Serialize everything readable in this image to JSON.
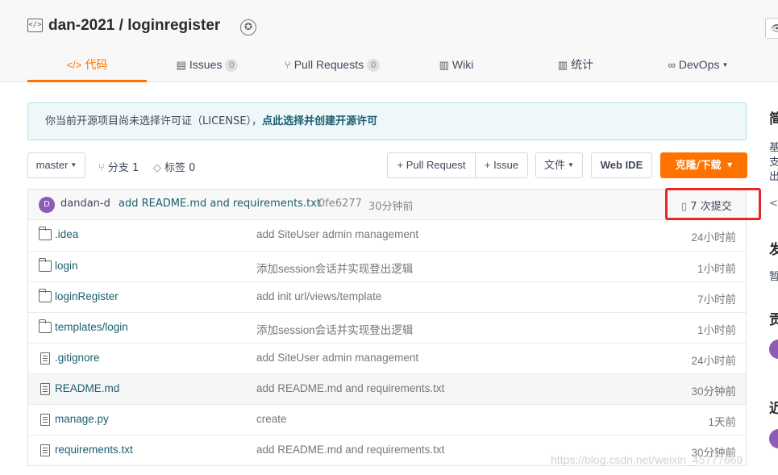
{
  "repo": {
    "title": "dan-2021 / loginregister"
  },
  "tabs": [
    {
      "icon": "</>",
      "label": "代码"
    },
    {
      "icon": "▤",
      "label": "Issues",
      "count": "0"
    },
    {
      "icon": "⑂",
      "label": "Pull Requests",
      "count": "0"
    },
    {
      "icon": "▥",
      "label": "Wiki"
    },
    {
      "icon": "▥",
      "label": "统计"
    },
    {
      "icon": "∞",
      "label": "DevOps"
    }
  ],
  "license": {
    "text": "你当前开源项目尚未选择许可证（LICENSE），",
    "link": "点此选择并创建开源许可"
  },
  "toolbar": {
    "branch": "master",
    "branches_label": "分支",
    "branches_count": "1",
    "tags_label": "标签",
    "tags_count": "0",
    "pull_request": "+ Pull Request",
    "issue": "+ Issue",
    "file": "文件",
    "web_ide": "Web IDE",
    "clone": "克隆/下载"
  },
  "commit": {
    "avatar_letter": "D",
    "author": "dandan-d",
    "message": "add README.md and requirements.txt",
    "sha": "0fe6277",
    "time": "30分钟前",
    "count": "7 次提交"
  },
  "files": [
    {
      "type": "folder",
      "name": ".idea",
      "message": "add SiteUser admin management",
      "time": "24小时前"
    },
    {
      "type": "folder",
      "name": "login",
      "message": "添加session会话并实现登出逻辑",
      "time": "1小时前"
    },
    {
      "type": "folder",
      "name": "loginRegister",
      "message": "add init url/views/template",
      "time": "7小时前"
    },
    {
      "type": "folder",
      "name": "templates/login",
      "message": "添加session会话并实现登出逻辑",
      "time": "1小时前"
    },
    {
      "type": "file",
      "name": ".gitignore",
      "message": "add SiteUser admin management",
      "time": "24小时前"
    },
    {
      "type": "file",
      "name": "README.md",
      "message": "add README.md and requirements.txt",
      "time": "30分钟前"
    },
    {
      "type": "file",
      "name": "manage.py",
      "message": "create",
      "time": "1天前"
    },
    {
      "type": "file",
      "name": "requirements.txt",
      "message": "add README.md and requirements.txt",
      "time": "30分钟前"
    }
  ],
  "sidebar": {
    "intro_heading": "简",
    "intro_lines": [
      "基",
      "支",
      "出"
    ],
    "code_marker": "</",
    "release_heading": "发",
    "release_text": "暂",
    "contrib_heading": "贡",
    "recent_heading": "近"
  },
  "watermark": "https://blog.csdn.net/weixin_45777669",
  "colors": {
    "accent": "#fe7300",
    "link": "#1a5e6f",
    "highlight_box": "#e8262a",
    "avatar": "#8e5bb5"
  }
}
